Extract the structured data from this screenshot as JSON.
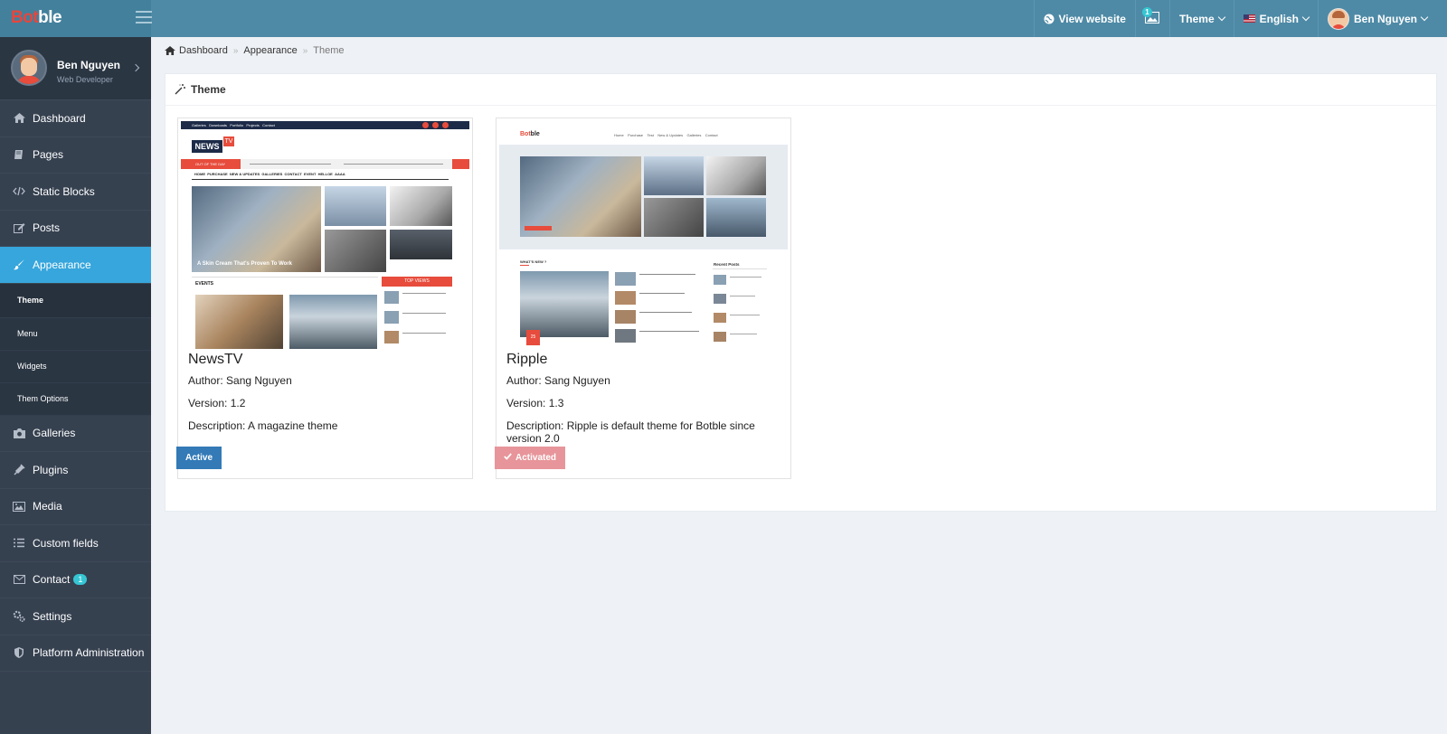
{
  "brand": {
    "logo_part1": "Bot",
    "logo_part2": "ble"
  },
  "header": {
    "view_website": "View website",
    "notification_count": "1",
    "theme_menu": "Theme",
    "language": "English",
    "user_name": "Ben Nguyen"
  },
  "sidebar": {
    "profile": {
      "name": "Ben Nguyen",
      "role": "Web Developer"
    },
    "items": [
      {
        "label": "Dashboard",
        "icon": "home-icon"
      },
      {
        "label": "Pages",
        "icon": "book-icon"
      },
      {
        "label": "Static Blocks",
        "icon": "code-icon"
      },
      {
        "label": "Posts",
        "icon": "edit-icon"
      },
      {
        "label": "Appearance",
        "icon": "paint-brush-icon"
      },
      {
        "label": "Galleries",
        "icon": "camera-icon"
      },
      {
        "label": "Plugins",
        "icon": "plug-icon"
      },
      {
        "label": "Media",
        "icon": "image-icon"
      },
      {
        "label": "Custom fields",
        "icon": "list-icon"
      },
      {
        "label": "Contact",
        "icon": "envelope-icon",
        "badge": "1"
      },
      {
        "label": "Settings",
        "icon": "cogs-icon"
      },
      {
        "label": "Platform Administration",
        "icon": "shield-icon"
      }
    ],
    "appearance_sub": [
      {
        "label": "Theme"
      },
      {
        "label": "Menu"
      },
      {
        "label": "Widgets"
      },
      {
        "label": "Them Options"
      }
    ]
  },
  "breadcrumb": {
    "items": [
      "Dashboard",
      "Appearance",
      "Theme"
    ]
  },
  "page": {
    "title": "Theme"
  },
  "themes": [
    {
      "name": "NewsTV",
      "author": "Author: Sang Nguyen",
      "version": "Version: 1.2",
      "description": "Description: A magazine theme",
      "button": "Active",
      "preview": {
        "nav": [
          "Galleries",
          "Downloads",
          "Portfolio",
          "Projects",
          "Contact"
        ],
        "logo": "NEWS",
        "logo_tv": "TV",
        "ticker_label": "OUT OF THE DAY",
        "menu": [
          "HOME",
          "PURCHASE",
          "NEW & UPDATES",
          "GALLERIES",
          "CONTACT",
          "EVENT",
          "HELLOE",
          "AAAA"
        ],
        "hero_caption": "A Skin Cream That's Proven To Work",
        "events_label": "EVENTS",
        "top_views_label": "TOP VIEWS"
      }
    },
    {
      "name": "Ripple",
      "author": "Author: Sang Nguyen",
      "version": "Version: 1.3",
      "description": "Description: Ripple is default theme for Botble since version 2.0",
      "button": "Activated",
      "preview": {
        "logo_part1": "Bot",
        "logo_part2": "ble",
        "nav": [
          "Home",
          "Purchase",
          "Test",
          "New & Updates",
          "Galleries",
          "Contact"
        ],
        "whats_new": "WHAT'S NEW ?",
        "recent_posts": "Recent Posts",
        "date_day": "25"
      }
    }
  ],
  "colors": {
    "header": "#4e8aa6",
    "sidebar": "#364150",
    "active_nav": "#36a6dc",
    "btn_active": "#337ab7",
    "btn_activated": "#e7959a"
  }
}
